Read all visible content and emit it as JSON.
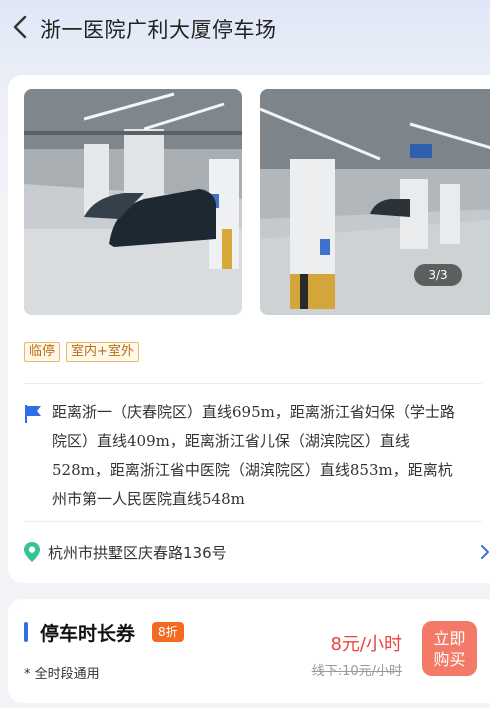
{
  "header": {
    "title": "浙一医院广利大厦停车场"
  },
  "gallery": {
    "pager": "3/3"
  },
  "tags": [
    "临停",
    "室内+室外"
  ],
  "distance_text": "距离浙一（庆春院区）直线695m，距离浙江省妇保（学士路院区）直线409m，距离浙江省儿保（湖滨院区）直线528m，距离浙江省中医院（湖滨院区）直线853m，距离杭州市第一人民医院直线548m",
  "address": "杭州市拱墅区庆春路136号",
  "coupon": {
    "title": "停车时长券",
    "discount": "8折",
    "usage": "* 全时段通用",
    "price": "8元/小时",
    "original_price": "线下:10元/小时",
    "buy_label": "立即购买"
  },
  "colors": {
    "accent": "#2f6fe6",
    "discount": "#f26b21",
    "price": "#e8453c",
    "buy": "#f27a66",
    "tag_text": "#b8701c"
  }
}
